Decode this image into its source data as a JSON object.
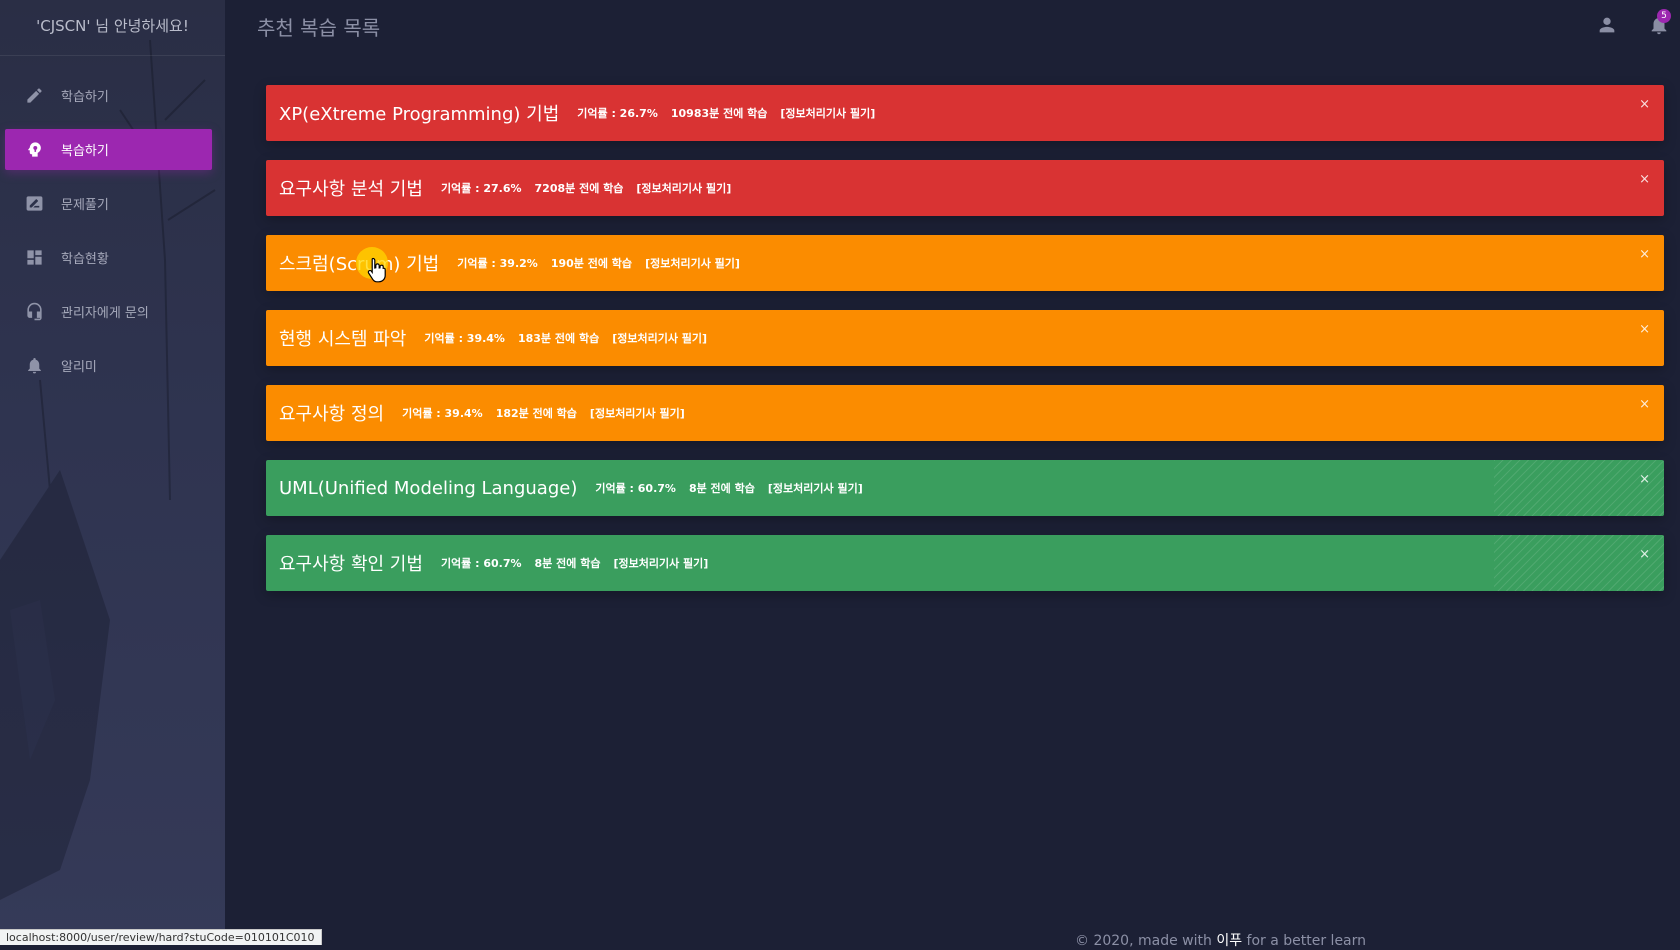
{
  "sidebar": {
    "greeting": "'CJSCN' 님 안녕하세요!",
    "items": [
      {
        "label": "학습하기",
        "icon": "pencil-icon",
        "active": false
      },
      {
        "label": "복습하기",
        "icon": "brain-head-icon",
        "active": true
      },
      {
        "label": "문제풀기",
        "icon": "draw-board-icon",
        "active": false
      },
      {
        "label": "학습현황",
        "icon": "dashboard-icon",
        "active": false
      },
      {
        "label": "관리자에게 문의",
        "icon": "headset-icon",
        "active": false
      },
      {
        "label": "알리미",
        "icon": "bell-icon",
        "active": false
      }
    ]
  },
  "header": {
    "title": "추천 복습 목록",
    "notification_count": "5",
    "user_icon": "person-icon",
    "bell_icon": "bell-icon"
  },
  "alerts": [
    {
      "title": "XP(eXtreme Programming) 기법",
      "memory": "기억률 : 26.7%",
      "ago": "10983분 전에 학습",
      "category": "[정보처리기사 필기]",
      "color": "#d93333"
    },
    {
      "title": "요구사항 분석 기법",
      "memory": "기억률 : 27.6%",
      "ago": "7208분 전에 학습",
      "category": "[정보처리기사 필기]",
      "color": "#d93333"
    },
    {
      "title": "스크럼(Scrum) 기법",
      "memory": "기억률 : 39.2%",
      "ago": "190분 전에 학습",
      "category": "[정보처리기사 필기]",
      "color": "#fb8c00"
    },
    {
      "title": "현행 시스템 파악",
      "memory": "기억률 : 39.4%",
      "ago": "183분 전에 학습",
      "category": "[정보처리기사 필기]",
      "color": "#fb8c00"
    },
    {
      "title": "요구사항 정의",
      "memory": "기억률 : 39.4%",
      "ago": "182분 전에 학습",
      "category": "[정보처리기사 필기]",
      "color": "#fb8c00"
    },
    {
      "title": "UML(Unified Modeling Language)",
      "memory": "기억률 : 60.7%",
      "ago": "8분 전에 학습",
      "category": "[정보처리기사 필기]",
      "color": "#3a9e5e"
    },
    {
      "title": "요구사항 확인 기법",
      "memory": "기억률 : 60.7%",
      "ago": "8분 전에 학습",
      "category": "[정보처리기사 필기]",
      "color": "#3a9e5e"
    }
  ],
  "close_symbol": "×",
  "status_bar": {
    "url": "localhost:8000/user/review/hard?stuCode=010101C010"
  },
  "footer": {
    "text_prefix": "© 2020, made with ",
    "highlight": "이푸",
    "text_suffix": " for a better learn"
  }
}
